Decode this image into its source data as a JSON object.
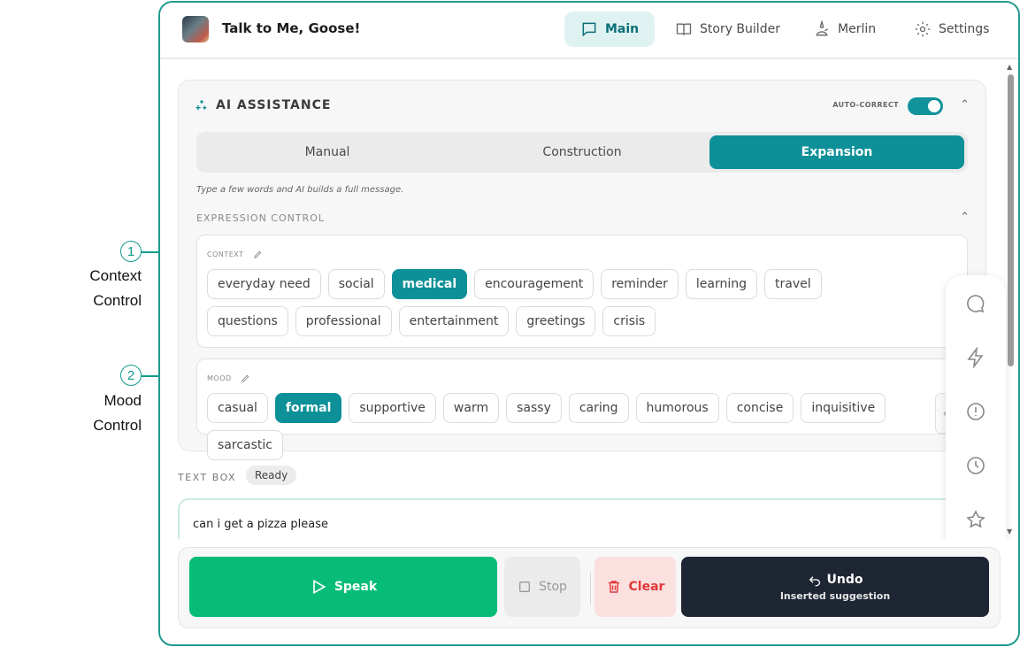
{
  "annotations": [
    {
      "number": "1",
      "label_line1": "Context",
      "label_line2": "Control"
    },
    {
      "number": "2",
      "label_line1": "Mood",
      "label_line2": "Control"
    }
  ],
  "app": {
    "title": "Talk to Me, Goose!"
  },
  "nav": [
    {
      "label": "Main",
      "icon": "chat-icon",
      "active": true
    },
    {
      "label": "Story Builder",
      "icon": "book-icon",
      "active": false
    },
    {
      "label": "Merlin",
      "icon": "wizard-icon",
      "active": false
    },
    {
      "label": "Settings",
      "icon": "gear-icon",
      "active": false
    }
  ],
  "ai_assistance": {
    "title": "AI ASSISTANCE",
    "autocorrect_label": "AUTO-CORRECT",
    "autocorrect_on": true,
    "modes": [
      "Manual",
      "Construction",
      "Expansion"
    ],
    "active_mode": "Expansion",
    "hint": "Type a few words and AI builds a full message.",
    "expression_label": "EXPRESSION CONTROL",
    "context": {
      "label": "CONTEXT",
      "options": [
        "everyday need",
        "social",
        "medical",
        "encouragement",
        "reminder",
        "learning",
        "travel",
        "questions",
        "professional",
        "entertainment",
        "greetings",
        "crisis"
      ],
      "selected": "medical"
    },
    "mood": {
      "label": "MOOD",
      "options": [
        "casual",
        "formal",
        "supportive",
        "warm",
        "sassy",
        "caring",
        "humorous",
        "concise",
        "inquisitive",
        "sarcastic"
      ],
      "selected": "formal"
    }
  },
  "textbox": {
    "label": "TEXT BOX",
    "status": "Ready",
    "value": "can i get a pizza please"
  },
  "side_tools": [
    "chat-bubble-icon",
    "lightning-icon",
    "alert-icon",
    "clock-icon",
    "star-icon"
  ],
  "actions": {
    "speak": "Speak",
    "stop": "Stop",
    "clear": "Clear",
    "undo": "Undo",
    "undo_sub": "Inserted suggestion"
  },
  "colors": {
    "accent": "#0e9098",
    "speak": "#06bc78",
    "undo": "#1e2533",
    "clear": "#e03a3a",
    "frame": "#1f9a8c"
  }
}
